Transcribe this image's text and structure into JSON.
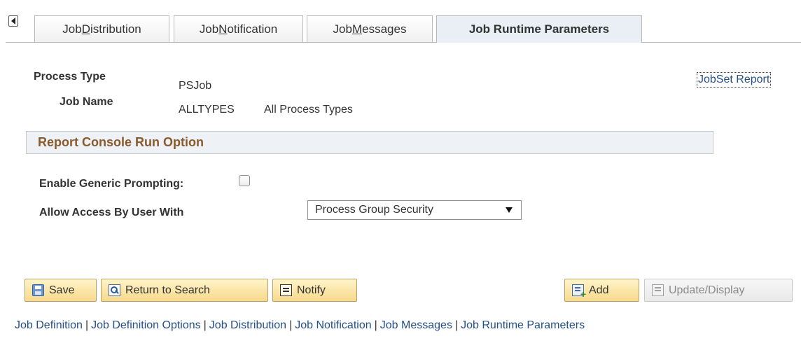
{
  "tabs": [
    {
      "pre": "Job ",
      "u": "D",
      "post": "istribution",
      "active": false
    },
    {
      "pre": "Job ",
      "u": "N",
      "post": "otification",
      "active": false
    },
    {
      "pre": "Job ",
      "u": "M",
      "post": "essages",
      "active": false
    },
    {
      "pre": "Job Runtime Parameters",
      "u": "",
      "post": "",
      "active": true
    }
  ],
  "header": {
    "process_type_label": "Process Type",
    "process_type_value": "PSJob",
    "job_name_label": "Job Name",
    "job_name_value": "ALLTYPES",
    "job_name_desc": "All Process Types",
    "jobset_report_link": "JobSet Report"
  },
  "section": {
    "title": "Report Console Run Option",
    "generic_prompting_label": "Enable Generic Prompting:",
    "generic_prompting_checked": false,
    "allow_access_label": "Allow Access By User With",
    "allow_access_value": "Process Group Security"
  },
  "toolbar": {
    "save": "Save",
    "return_to_search": "Return to Search",
    "notify": "Notify",
    "add": "Add",
    "update_display": "Update/Display"
  },
  "footer_links": [
    "Job Definition",
    "Job Definition Options",
    "Job Distribution",
    "Job Notification",
    "Job Messages",
    "Job Runtime Parameters"
  ]
}
